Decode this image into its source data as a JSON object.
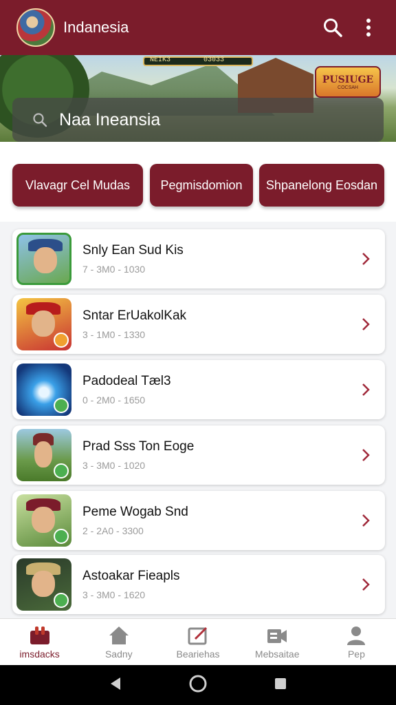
{
  "appbar": {
    "title": "Indanesia",
    "icons": [
      "app-avatar",
      "search-icon",
      "more-vert-icon"
    ]
  },
  "banner": {
    "hud_left": "NEIK3",
    "hud_right": "03033",
    "logo_line1": "PUSIUGE",
    "logo_line2": "COCSAH"
  },
  "search": {
    "value": "Naa Ineansia",
    "icon": "search-icon"
  },
  "filters": [
    {
      "label": "Vlavagr Cel Mudas"
    },
    {
      "label": "Pegmisdomion"
    },
    {
      "label": "Shpanelong Eosdan"
    }
  ],
  "games": [
    {
      "title": "Snly Ean Sud Kis",
      "meta": "7 - 3M0 - 1030",
      "icon": "game-thumb-1"
    },
    {
      "title": "Sntar ErUakolKak",
      "meta": "3 - 1M0 - 1330",
      "icon": "game-thumb-2"
    },
    {
      "title": "Padodeal Tæl3",
      "meta": "0 - 2M0 - 1650",
      "icon": "game-thumb-3"
    },
    {
      "title": "Prad Sss Ton Eoge",
      "meta": "3 - 3M0 - 1020",
      "icon": "game-thumb-4"
    },
    {
      "title": "Peme Wogab Snd",
      "meta": "2 - 2A0 - 3300",
      "icon": "game-thumb-5"
    },
    {
      "title": "Astoakar Fieapls",
      "meta": "3 - 3M0 - 1620",
      "icon": "game-thumb-6"
    }
  ],
  "bottom_nav": [
    {
      "label": "imsdacks",
      "icon": "games-icon",
      "active": true
    },
    {
      "label": "Sadny",
      "icon": "home-icon"
    },
    {
      "label": "Beariehas",
      "icon": "edit-photo-icon"
    },
    {
      "label": "Mebsaitae",
      "icon": "media-icon"
    },
    {
      "label": "Pep",
      "icon": "person-icon"
    }
  ],
  "system_nav": [
    "back-icon",
    "home-circle-icon",
    "recents-icon"
  ],
  "colors": {
    "brand": "#7b1c2b",
    "accent_green": "#4caf50",
    "surface": "#ffffff",
    "muted_text": "#9a9a9a"
  }
}
